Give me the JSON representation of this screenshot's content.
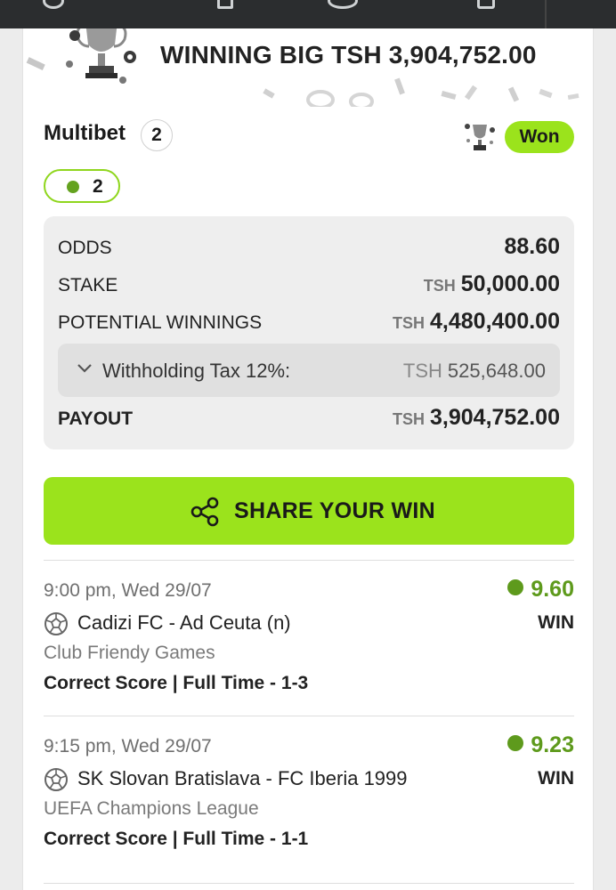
{
  "banner": {
    "text": "WINNING BIG TSH 3,904,752.00"
  },
  "bet": {
    "type_label": "Multibet",
    "selection_count": "2",
    "status": "Won",
    "legs_won": "2"
  },
  "summary": {
    "odds_label": "ODDS",
    "odds_value": "88.60",
    "stake_label": "STAKE",
    "stake_currency": "TSH",
    "stake_value": "50,000.00",
    "potential_label": "POTENTIAL WINNINGS",
    "potential_currency": "TSH",
    "potential_value": "4,480,400.00",
    "tax_label": "Withholding Tax 12%:",
    "tax_currency": "TSH",
    "tax_value": "525,648.00",
    "payout_label": "PAYOUT",
    "payout_currency": "TSH",
    "payout_value": "3,904,752.00"
  },
  "share": {
    "label": "SHARE YOUR WIN"
  },
  "selections": [
    {
      "time": "9:00 pm, Wed 29/07",
      "odds": "9.60",
      "match": "Cadizi FC - Ad Ceuta (n)",
      "result": "WIN",
      "league": "Club Friendy Games",
      "market": "Correct Score | Full Time - 1-3"
    },
    {
      "time": "9:15 pm, Wed 29/07",
      "odds": "9.23",
      "match": "SK Slovan Bratislava - FC Iberia 1999",
      "result": "WIN",
      "league": "UEFA Champions League",
      "market": "Correct Score | Full Time - 1-1"
    }
  ],
  "icons": {
    "topbar": [
      "soccer-ball-icon",
      "pulse-icon",
      "live-icon",
      "trophy-icon"
    ],
    "trophy": "trophy-icon",
    "share": "share-icon",
    "ball": "soccer-ball-icon",
    "chevron": "chevron-down-icon"
  },
  "colors": {
    "accent": "#9be31c",
    "win_green": "#5e9a1c",
    "topbar": "#2b2d2f"
  }
}
